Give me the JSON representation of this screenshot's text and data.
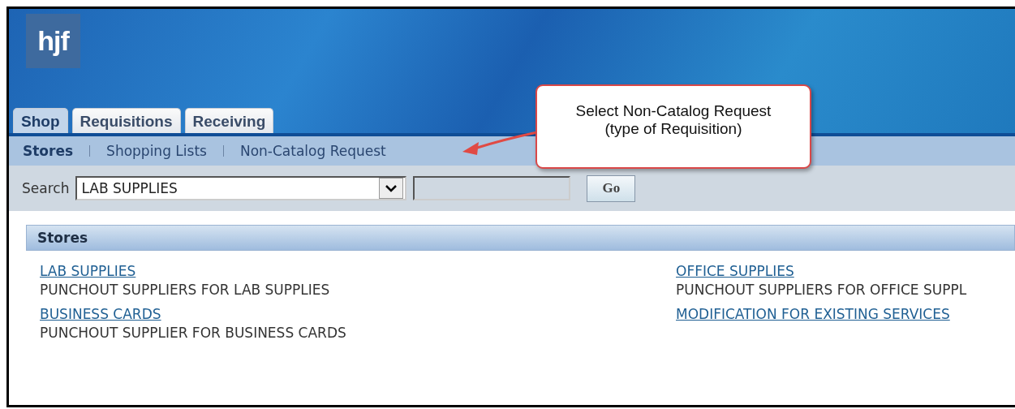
{
  "logo": {
    "text": "hjf"
  },
  "tabs": [
    {
      "label": "Shop",
      "selected": true
    },
    {
      "label": "Requisitions",
      "selected": false
    },
    {
      "label": "Receiving",
      "selected": false
    }
  ],
  "subnav": [
    {
      "label": "Stores",
      "selected": true
    },
    {
      "label": "Shopping Lists",
      "selected": false
    },
    {
      "label": "Non-Catalog Request",
      "selected": false
    }
  ],
  "search": {
    "label": "Search",
    "value": "LAB SUPPLIES",
    "button": "Go"
  },
  "stores": {
    "title": "Stores",
    "items": [
      {
        "name": "LAB SUPPLIES",
        "description": "PUNCHOUT SUPPLIERS FOR LAB SUPPLIES"
      },
      {
        "name": "OFFICE SUPPLIES",
        "description": "PUNCHOUT SUPPLIERS FOR OFFICE SUPPL"
      },
      {
        "name": "BUSINESS CARDS",
        "description": "PUNCHOUT SUPPLIER FOR BUSINESS CARDS"
      },
      {
        "name": "MODIFICATION FOR EXISTING SERVICES"
      }
    ]
  },
  "callout": {
    "lines": [
      "Select Non-Catalog Request",
      "(type of Requisition)"
    ]
  }
}
